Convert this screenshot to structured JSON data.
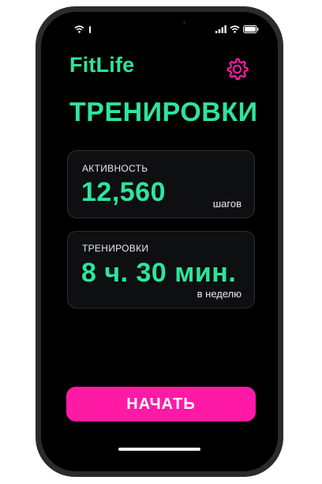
{
  "app": {
    "name": "FitLife",
    "accent_color": "#2ee59d",
    "cta_color": "#ff1aa6"
  },
  "header": {
    "settings_icon": "gear-icon"
  },
  "page": {
    "title": "ТРЕНИРОВКИ"
  },
  "cards": [
    {
      "label": "АКТИВНОСТЬ",
      "value": "12,560",
      "unit": "шагов"
    },
    {
      "label": "ТРЕНИРОВКИ",
      "value": "8 ч. 30 мин.",
      "unit": "в неделю"
    }
  ],
  "actions": {
    "start_label": "НАЧАТЬ"
  },
  "status_bar": {
    "icons": [
      "wifi-icon",
      "sim-indicator-icon",
      "cellular-signal-icon",
      "wifi-icon",
      "battery-icon"
    ]
  }
}
